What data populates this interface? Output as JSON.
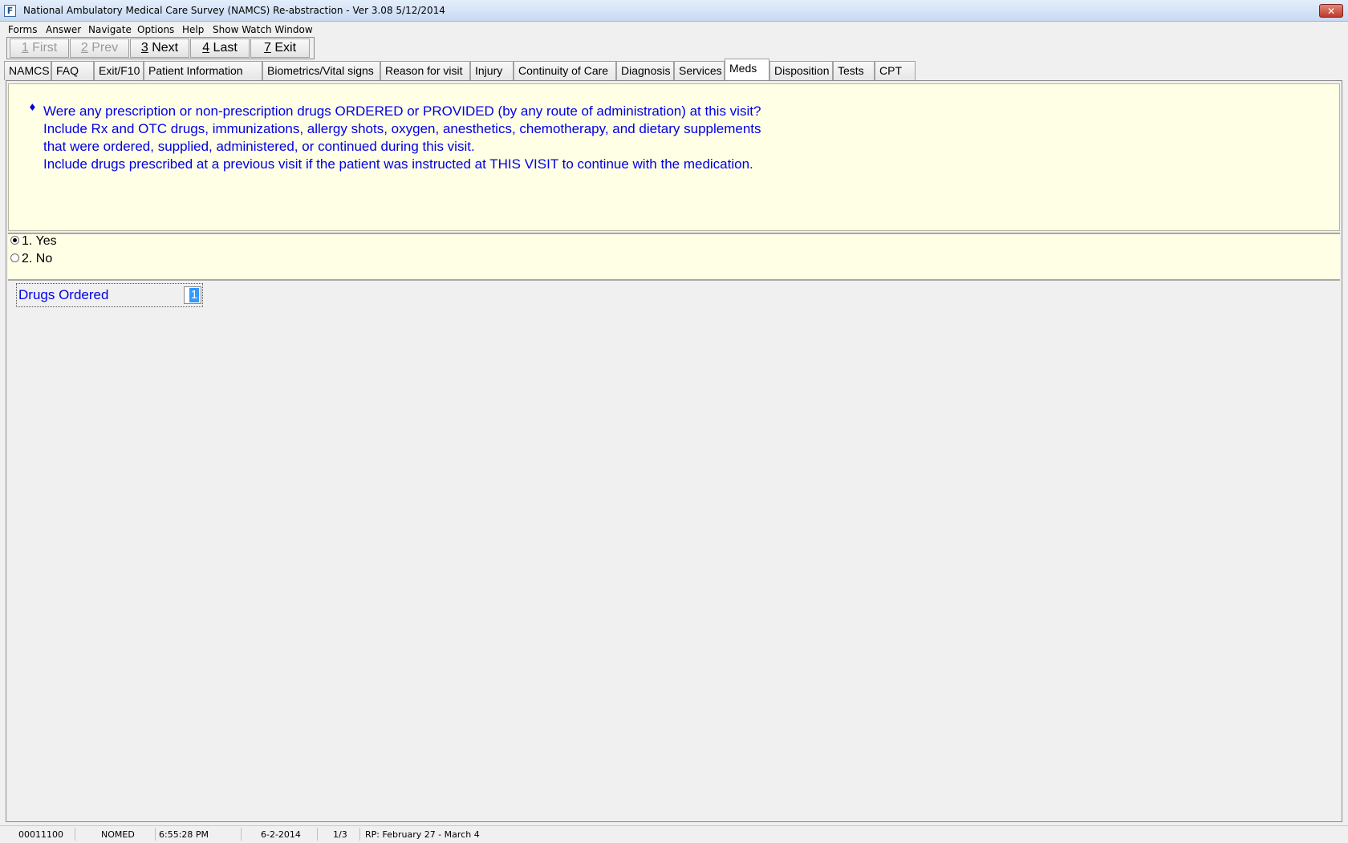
{
  "window": {
    "title": "National Ambulatory Medical Care Survey (NAMCS) Re-abstraction  - Ver 3.08 5/12/2014",
    "icon": "app-form-icon",
    "close_label": "✕"
  },
  "menu": {
    "items": [
      "Forms",
      "Answer",
      "Navigate",
      "Options",
      "Help",
      "Show Watch Window"
    ]
  },
  "nav": {
    "buttons": [
      {
        "key": "1",
        "label": " First",
        "enabled": false
      },
      {
        "key": "2",
        "label": " Prev",
        "enabled": false
      },
      {
        "key": "3",
        "label": " Next",
        "enabled": true
      },
      {
        "key": "4",
        "label": " Last",
        "enabled": true
      },
      {
        "key": "7",
        "label": " Exit",
        "enabled": true
      }
    ]
  },
  "tabs": [
    "NAMCS",
    "FAQ",
    "Exit/F10",
    "Patient Information",
    "Biometrics/Vital signs",
    "Reason for visit",
    "Injury",
    "Continuity of Care",
    "Diagnosis",
    "Services",
    "Meds",
    "Disposition",
    "Tests",
    "CPT"
  ],
  "active_tab": "Meds",
  "question": {
    "bullet": "♦",
    "lines": [
      "Were any prescription or non-prescription drugs ORDERED or PROVIDED (by any route of administration) at this visit?",
      "Include Rx and OTC drugs, immunizations, allergy shots, oxygen, anesthetics, chemotherapy, and dietary supplements",
      "that were ordered, supplied, administered, or continued during this visit.",
      "Include drugs prescribed at a previous visit if the patient was instructed at THIS VISIT to continue with the medication."
    ]
  },
  "answers": [
    {
      "label": "1. Yes",
      "selected": true
    },
    {
      "label": "2. No",
      "selected": false
    }
  ],
  "field": {
    "label": "Drugs Ordered",
    "value": "1"
  },
  "status": {
    "case_id": "00011100",
    "mode": "NOMED",
    "time": "6:55:28 PM",
    "date": "6-2-2014",
    "page": "1/3",
    "period": "RP: February 27 - March 4"
  },
  "colors": {
    "question_text": "#0000e6",
    "panel_background": "#ffffe6",
    "selection": "#3399ff"
  }
}
